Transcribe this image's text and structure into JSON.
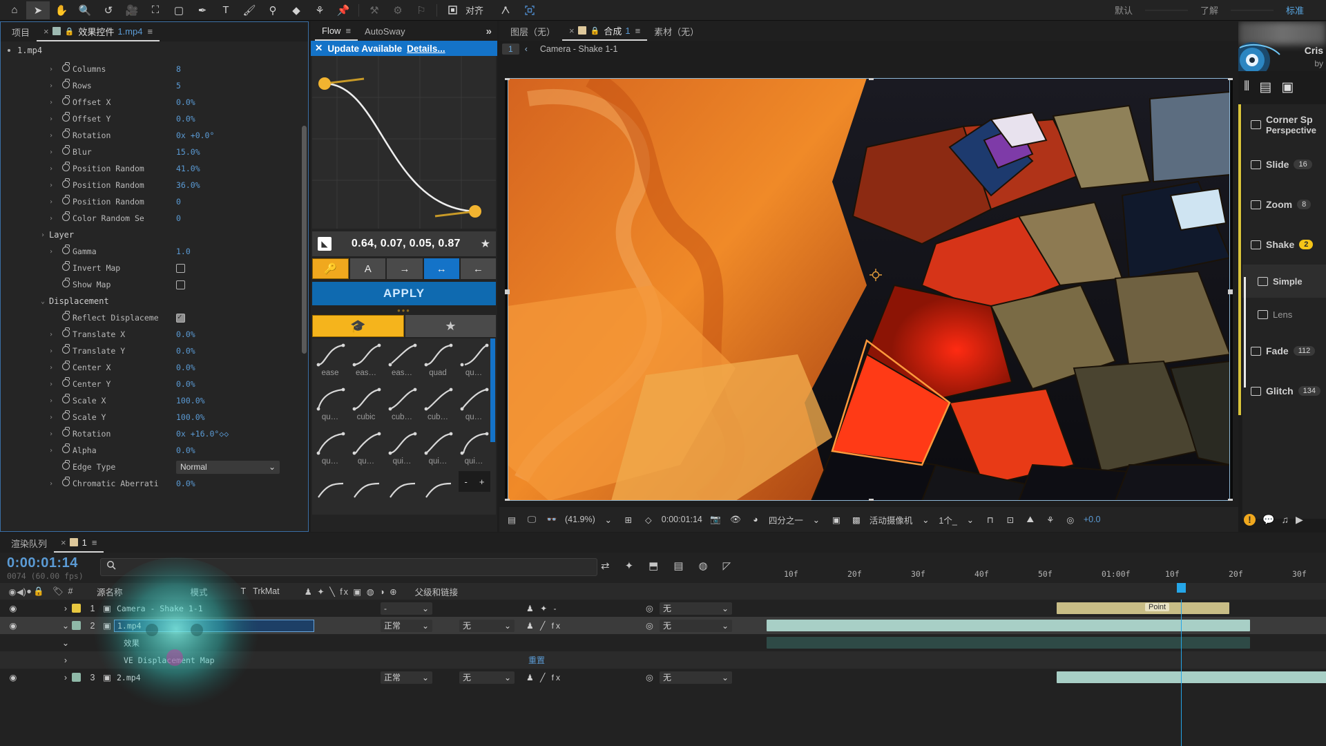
{
  "toolbar": {
    "tools": [
      {
        "name": "home-icon",
        "glyph": "⌂",
        "selected": false
      },
      {
        "name": "selection-tool-icon",
        "glyph": "➤",
        "selected": true
      },
      {
        "name": "hand-tool-icon",
        "glyph": "✋",
        "selected": false
      },
      {
        "name": "zoom-tool-icon",
        "glyph": "🔍",
        "selected": false
      },
      {
        "name": "rotation-tool-icon",
        "glyph": "↺",
        "selected": false
      },
      {
        "name": "camera-tool-icon",
        "glyph": "🎥",
        "selected": false
      },
      {
        "name": "anchor-point-tool-icon",
        "glyph": "⛶",
        "selected": false
      },
      {
        "name": "shape-tool-icon",
        "glyph": "▢",
        "selected": false
      },
      {
        "name": "pen-tool-icon",
        "glyph": "✒",
        "selected": false
      },
      {
        "name": "type-tool-icon",
        "glyph": "T",
        "selected": false
      },
      {
        "name": "brush-tool-icon",
        "glyph": "🖌",
        "selected": false
      },
      {
        "name": "clone-stamp-tool-icon",
        "glyph": "⚲",
        "selected": false
      },
      {
        "name": "eraser-tool-icon",
        "glyph": "◆",
        "selected": false
      },
      {
        "name": "roto-brush-tool-icon",
        "glyph": "⚘",
        "selected": false
      },
      {
        "name": "puppet-pin-tool-icon",
        "glyph": "📌",
        "selected": false
      }
    ],
    "dim_tools": [
      {
        "name": "puppet-overlap-tool-icon",
        "glyph": "⚒"
      },
      {
        "name": "puppet-bend-tool-icon",
        "glyph": "⚙"
      },
      {
        "name": "puppet-starch-tool-icon",
        "glyph": "⚐"
      }
    ],
    "align_label": "对齐",
    "align_icon": "□",
    "extra_icons": [
      {
        "name": "snapping-icon",
        "glyph": "⌁"
      },
      {
        "name": "grid-guides-icon",
        "glyph": "▩"
      }
    ],
    "workspaces": [
      {
        "label": "默认",
        "active": false
      },
      {
        "label": "了解",
        "active": false
      },
      {
        "label": "标准",
        "active": true
      }
    ]
  },
  "effect_controls": {
    "tabs": [
      {
        "label": "项目",
        "active": false,
        "closable": false
      },
      {
        "label": "效果控件",
        "active": true,
        "closable": true,
        "file": "1.mp4",
        "swatch": "#9db9b1",
        "locked": true
      }
    ],
    "header": "1.mp4",
    "properties": [
      {
        "indent": 1,
        "twirl": "›",
        "stopwatch": true,
        "name": "Columns",
        "value": "8",
        "type": "num"
      },
      {
        "indent": 1,
        "twirl": "›",
        "stopwatch": true,
        "name": "Rows",
        "value": "5",
        "type": "num"
      },
      {
        "indent": 1,
        "twirl": "›",
        "stopwatch": true,
        "name": "Offset X",
        "value": "0.0%",
        "type": "num"
      },
      {
        "indent": 1,
        "twirl": "›",
        "stopwatch": true,
        "name": "Offset Y",
        "value": "0.0%",
        "type": "num"
      },
      {
        "indent": 1,
        "twirl": "›",
        "stopwatch": true,
        "name": "Rotation",
        "value": "0x +0.0°",
        "type": "num"
      },
      {
        "indent": 1,
        "twirl": "›",
        "stopwatch": true,
        "name": "Blur",
        "value": "15.0%",
        "type": "num"
      },
      {
        "indent": 1,
        "twirl": "›",
        "stopwatch": true,
        "name": "Position Random",
        "value": "41.0%",
        "type": "num"
      },
      {
        "indent": 1,
        "twirl": "›",
        "stopwatch": true,
        "name": "Position Random",
        "value": "36.0%",
        "type": "num"
      },
      {
        "indent": 1,
        "twirl": "›",
        "stopwatch": true,
        "name": "Position Random",
        "value": "0",
        "type": "num"
      },
      {
        "indent": 1,
        "twirl": "›",
        "stopwatch": true,
        "name": "Color Random Se",
        "value": "0",
        "type": "num"
      },
      {
        "indent": 0,
        "twirl": "›",
        "stopwatch": false,
        "name": "Layer",
        "value": "",
        "type": "group"
      },
      {
        "indent": 0,
        "twirl": "›",
        "stopwatch": true,
        "name": "Gamma",
        "value": "1.0",
        "type": "num"
      },
      {
        "indent": 1,
        "twirl": "",
        "stopwatch": true,
        "name": "Invert Map",
        "value": "",
        "type": "checkbox",
        "checked": false
      },
      {
        "indent": 1,
        "twirl": "",
        "stopwatch": true,
        "name": "Show Map",
        "value": "",
        "type": "checkbox",
        "checked": false
      },
      {
        "indent": 0,
        "twirl": "⌄",
        "stopwatch": false,
        "name": "Displacement",
        "value": "",
        "type": "group"
      },
      {
        "indent": 1,
        "twirl": "",
        "stopwatch": true,
        "name": "Reflect Displaceme",
        "value": "",
        "type": "checkbox",
        "checked": true
      },
      {
        "indent": 1,
        "twirl": "›",
        "stopwatch": true,
        "name": "Translate X",
        "value": "0.0%",
        "type": "num"
      },
      {
        "indent": 1,
        "twirl": "›",
        "stopwatch": true,
        "name": "Translate Y",
        "value": "0.0%",
        "type": "num"
      },
      {
        "indent": 1,
        "twirl": "›",
        "stopwatch": true,
        "name": "Center X",
        "value": "0.0%",
        "type": "num"
      },
      {
        "indent": 1,
        "twirl": "›",
        "stopwatch": true,
        "name": "Center Y",
        "value": "0.0%",
        "type": "num"
      },
      {
        "indent": 1,
        "twirl": "›",
        "stopwatch": true,
        "name": "Scale X",
        "value": "100.0%",
        "type": "num"
      },
      {
        "indent": 1,
        "twirl": "›",
        "stopwatch": true,
        "name": "Scale Y",
        "value": "100.0%",
        "type": "num"
      },
      {
        "indent": 1,
        "twirl": "›",
        "stopwatch": true,
        "name": "Rotation",
        "value": "0x +16.0°◇◇",
        "type": "num"
      },
      {
        "indent": 1,
        "twirl": "›",
        "stopwatch": true,
        "name": "Alpha",
        "value": "0.0%",
        "type": "num"
      },
      {
        "indent": 1,
        "twirl": "",
        "stopwatch": true,
        "name": "Edge Type",
        "value": "Normal",
        "type": "select"
      },
      {
        "indent": 1,
        "twirl": "›",
        "stopwatch": true,
        "name": "Chromatic Aberrati",
        "value": "0.0%",
        "type": "num"
      }
    ]
  },
  "flow": {
    "tabs": [
      {
        "label": "Flow",
        "active": true
      },
      {
        "label": "AutoSway",
        "active": false
      }
    ],
    "overflow_icon": "»",
    "notice": {
      "close": "✕",
      "text": "Update Available",
      "link": "Details..."
    },
    "bezier_value": "0.64, 0.07, 0.05, 0.87",
    "bezier_icon": "graph-edit-icon",
    "favorite_icon": "★",
    "mode_buttons": [
      {
        "name": "keyframe-mode-button",
        "glyph": "🔑",
        "state": "amber"
      },
      {
        "name": "text-mode-button",
        "glyph": "A",
        "state": "off"
      },
      {
        "name": "ease-out-button",
        "glyph": "→",
        "state": "off"
      },
      {
        "name": "ease-both-button",
        "glyph": "↔",
        "state": "on"
      },
      {
        "name": "ease-in-button",
        "glyph": "←",
        "state": "off"
      }
    ],
    "apply_label": "APPLY",
    "divider_dots": "•••",
    "filter_tabs": [
      {
        "name": "presets-tab",
        "glyph": "🎓",
        "state": "amber"
      },
      {
        "name": "favorites-tab",
        "glyph": "★",
        "state": "off"
      }
    ],
    "presets": [
      [
        "ease",
        "eas…",
        "eas…",
        "quad",
        "qu…"
      ],
      [
        "qu…",
        "cubic",
        "cub…",
        "cub…",
        "qu…"
      ],
      [
        "qu…",
        "qu…",
        "qui…",
        "qui…",
        "qui…"
      ]
    ],
    "minus_label": "-",
    "plus_label": "+"
  },
  "composition": {
    "tabs": [
      {
        "label": "图层（无）",
        "active": false
      },
      {
        "label": "合成",
        "active": true,
        "file": "1",
        "closable": true,
        "swatch": "#dec89b",
        "locked": true
      },
      {
        "label": "素材（无）",
        "active": false
      }
    ],
    "flow_index": "1",
    "flow_back": "‹",
    "comp_name": "Camera - Shake 1-1",
    "footer": {
      "zoom": "(41.9%)",
      "timecode": "0:00:01:14",
      "resolution": "四分之一",
      "camera": "活动摄像机",
      "views": "1个_",
      "exposure": "+0.0",
      "icons_left": [
        "toggle-transparency-icon",
        "monitor-icon",
        "3d-glasses-icon"
      ],
      "icons_mid": [
        "region-of-interest-icon",
        "mask-outline-icon",
        "snapshot-icon",
        "show-snapshot-icon",
        "channels-icon"
      ],
      "icons_right": [
        "toggle-mask-icon",
        "transparency-grid-icon",
        "guides-icon",
        "timeline-graph-icon",
        "renderer-icon",
        "reset-exposure-icon"
      ]
    }
  },
  "right_panel": {
    "title": "Cris",
    "subtitle": "by",
    "header_icons": [
      {
        "name": "sliders-icon",
        "glyph": "⦀"
      },
      {
        "name": "list-view-icon",
        "glyph": "▤"
      },
      {
        "name": "grid-view-icon",
        "glyph": "▣"
      }
    ],
    "items": [
      {
        "label": "Corner Sp",
        "sub": "Perspective",
        "badge": "",
        "kind": "preset",
        "active": false
      },
      {
        "label": "Slide",
        "badge": "16",
        "kind": "preset",
        "active": false
      },
      {
        "label": "Zoom",
        "badge": "8",
        "kind": "preset",
        "active": false
      },
      {
        "label": "Shake",
        "badge": "2",
        "kind": "preset",
        "active": true,
        "badge_amber": true
      },
      {
        "label": "Simple",
        "badge": "",
        "kind": "ae",
        "active": true
      },
      {
        "label": "Lens",
        "badge": "",
        "kind": "ae",
        "active": false
      },
      {
        "label": "Fade",
        "badge": "112",
        "kind": "preset",
        "active": false
      },
      {
        "label": "Glitch",
        "badge": "134",
        "kind": "preset",
        "active": false
      }
    ],
    "footer_icons": [
      {
        "name": "warning-icon",
        "glyph": "!"
      },
      {
        "name": "chat-icon",
        "glyph": "💬"
      },
      {
        "name": "music-icon",
        "glyph": "♫"
      },
      {
        "name": "play-icon",
        "glyph": "▶"
      }
    ]
  },
  "timeline": {
    "tabs": [
      {
        "label": "渲染队列",
        "active": false
      },
      {
        "label": "1",
        "active": true,
        "closable": true,
        "swatch": "#dec89b"
      }
    ],
    "current_time": "0:00:01:14",
    "frame_info": "0074 (60.00 fps)",
    "search_placeholder": "",
    "search_icon": "search-icon",
    "toolbar_icons": [
      "composition-mini-flowchart-icon",
      "draft-3d-icon",
      "hide-shy-icon",
      "frame-blending-icon",
      "motion-blur-icon",
      "graph-editor-icon"
    ],
    "columns": {
      "source_name": "源名称",
      "mode": "模式",
      "t": "T",
      "trkmat": "TrkMat",
      "parent": "父级和链接",
      "switches": "♟ ✦ ╲ fx ▣ ◍ ◑ ⊕"
    },
    "ruler_ticks": [
      "10f",
      "20f",
      "30f",
      "40f",
      "50f",
      "01:00f",
      "10f",
      "20f",
      "30f"
    ],
    "layers": [
      {
        "index": "1",
        "name": "Camera - Shake 1-1",
        "swatch": "#e8c840",
        "mode": "-",
        "trkmat": "",
        "parent": "无",
        "selected": false,
        "twirl": "›"
      },
      {
        "index": "2",
        "name": "1.mp4",
        "swatch": "#8fb9a8",
        "mode": "正常",
        "trkmat": "无",
        "parent": "无",
        "selected": true,
        "twirl": "⌄",
        "renaming": true
      },
      {
        "index": "",
        "name": "效果",
        "swatch": "",
        "mode": "",
        "trkmat": "",
        "parent": "",
        "selected": false,
        "twirl": "⌄",
        "is_sub": true
      },
      {
        "index": "",
        "name": "VE Displacement Map",
        "swatch": "",
        "mode": "",
        "trkmat": "",
        "parent": "重置",
        "selected": false,
        "twirl": "›",
        "is_sub": true
      },
      {
        "index": "3",
        "name": "2.mp4",
        "swatch": "#8fb9a8",
        "mode": "正常",
        "trkmat": "无",
        "parent": "无",
        "selected": false,
        "twirl": "›"
      }
    ],
    "point_label": "Point"
  }
}
